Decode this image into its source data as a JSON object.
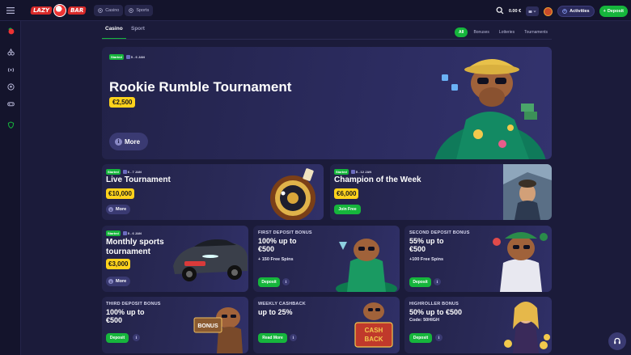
{
  "header": {
    "logo_left": "LAZY",
    "logo_right": "BAR",
    "tabs": [
      {
        "label": "Casino",
        "icon": "casino-chip-icon"
      },
      {
        "label": "Sports",
        "icon": "soccer-ball-icon"
      }
    ],
    "balance": "0.00 €",
    "activities_label": "Activities",
    "deposit_label": "Deposit"
  },
  "sidebar": {
    "icons": [
      "lazybar-logo-icon",
      "cherry-icon",
      "live-broadcast-icon",
      "soccer-ball-icon",
      "gamepad-icon",
      "shield-icon"
    ]
  },
  "nav": {
    "tabs": [
      {
        "label": "Casino",
        "active": true
      },
      {
        "label": "Sport",
        "active": false
      }
    ],
    "filters": [
      {
        "label": "All",
        "active": true
      },
      {
        "label": "Bonuses",
        "active": false
      },
      {
        "label": "Lotteries",
        "active": false
      },
      {
        "label": "Tournaments",
        "active": false
      }
    ]
  },
  "hero": {
    "status": "Started",
    "dates": "5 - 6 JAN",
    "title": "Rookie Rumble Tournament",
    "prize": "€2,500",
    "button": "More"
  },
  "live_tournament": {
    "status": "Started",
    "dates": "6 - 7 JAN",
    "title": "Live Tournament",
    "prize": "€10,000",
    "button": "More"
  },
  "champion": {
    "status": "Started",
    "dates": "5 - 12 JAN",
    "title": "Champion of the Week",
    "prize": "€6,000",
    "button": "Join Free"
  },
  "monthly_sports": {
    "status": "Started",
    "dates": "5 - 6 JAN",
    "title_line1": "Monthly sports",
    "title_line2": "tournament",
    "prize": "€3,000",
    "button": "More"
  },
  "first_deposit": {
    "label": "FIRST DEPOSIT BONUS",
    "title_line1": "100% up to",
    "title_line2": "€500",
    "sub": "+ 150 Free Spins",
    "button": "Deposit"
  },
  "second_deposit": {
    "label": "SECOND DEPOSIT BONUS",
    "title_line1": "55% up to",
    "title_line2": "€500",
    "sub": "+100 Free Spins",
    "button": "Deposit"
  },
  "third_deposit": {
    "label": "THIRD DEPOSIT BONUS",
    "title_line1": "100% up to",
    "title_line2": "€500",
    "button": "Deposit",
    "sign": "BONUS"
  },
  "weekly_cashback": {
    "label": "WEEKLY CASHBACK",
    "title": "up to 25%",
    "button": "Read More",
    "sign_line1": "CASH",
    "sign_line2": "BACK"
  },
  "highroller": {
    "label": "HIGHROLLER BONUS",
    "title": "50% up to €500",
    "sub": "Code: 50HIGH",
    "button": "Deposit"
  },
  "colors": {
    "background": "#1b1b3a",
    "accent_green": "#16b53c",
    "prize_yellow": "#ffd21c"
  }
}
